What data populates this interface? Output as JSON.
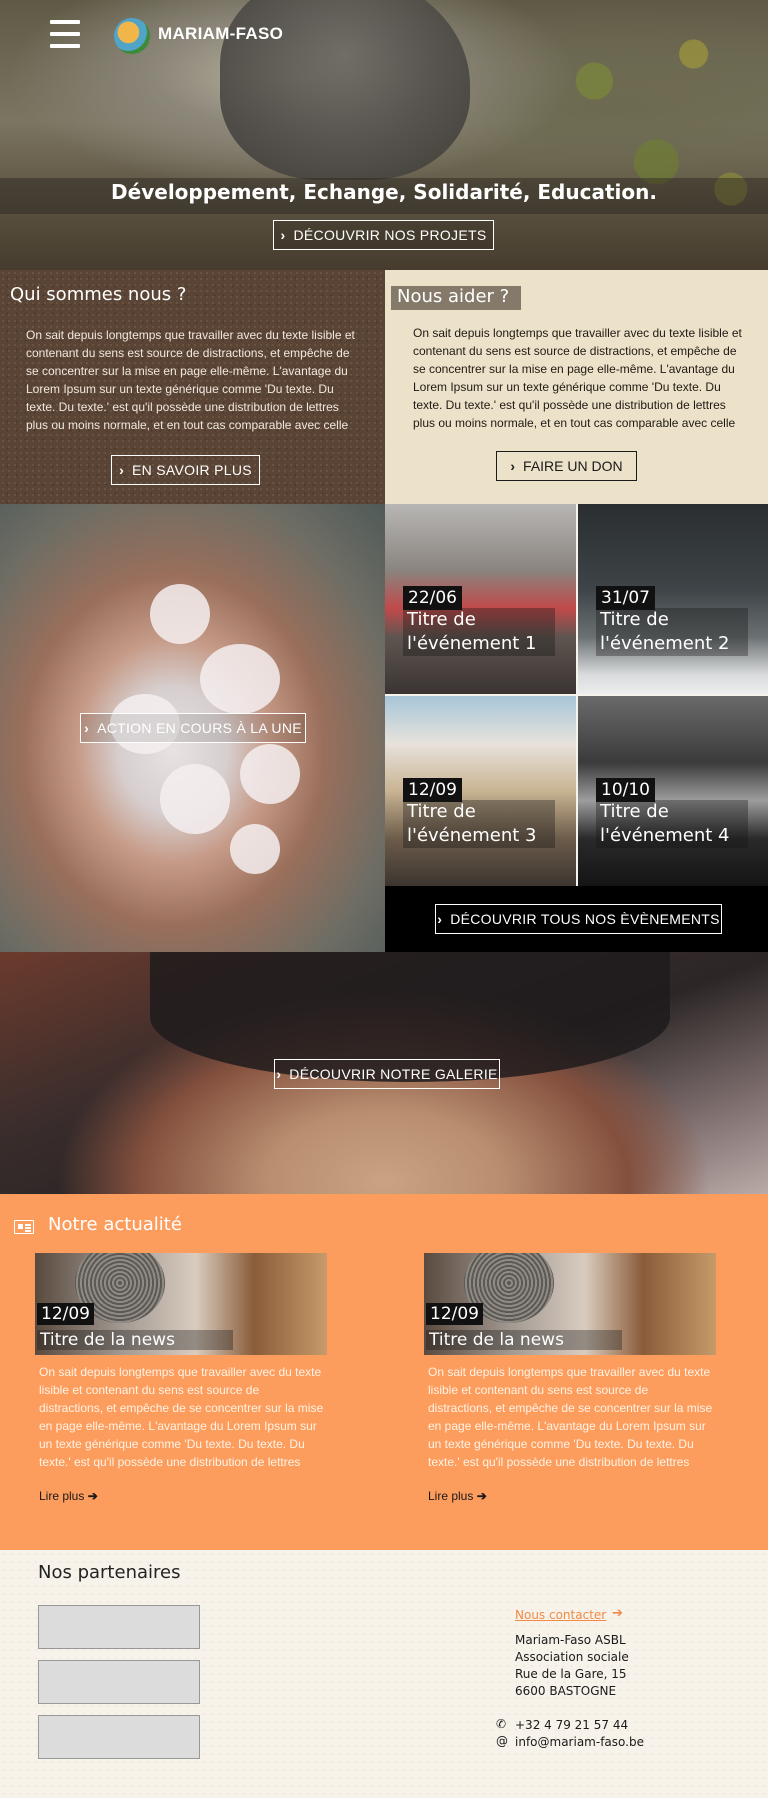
{
  "header": {
    "brand": "MARIAM-FASO",
    "tagline": "Développement, Echange, Solidarité, Education.",
    "cta": "DÉCOUVRIR NOS PROJETS"
  },
  "who": {
    "title": "Qui sommes nous ?",
    "text": "On sait depuis longtemps que travailler avec du texte lisible et contenant du sens est source de distractions, et empêche de se concentrer sur la mise en page elle-même. L'avantage du Lorem Ipsum sur un texte générique comme 'Du texte. Du texte. Du texte.' est qu'il possède une distribution de lettres plus ou moins normale, et en tout cas comparable avec celle",
    "button": "EN SAVOIR PLUS"
  },
  "help": {
    "title": "Nous aider ?",
    "text": "On sait depuis longtemps que travailler avec du texte lisible et contenant du sens est source de distractions, et empêche de se concentrer sur la mise en page elle-même. L'avantage du Lorem Ipsum sur un texte générique comme 'Du texte. Du texte. Du texte.' est qu'il possède une distribution de lettres plus ou moins normale, et en tout cas comparable avec celle",
    "button": "FAIRE UN DON"
  },
  "action": {
    "button": "ACTION EN COURS À LA UNE"
  },
  "events": {
    "items": [
      {
        "date": "22/06",
        "title": "Titre de l'événement 1"
      },
      {
        "date": "31/07",
        "title": "Titre de l'événement 2"
      },
      {
        "date": "12/09",
        "title": "Titre de l'événement 3"
      },
      {
        "date": "10/10",
        "title": "Titre de l'événement 4"
      }
    ],
    "button": "DÉCOUVRIR TOUS NOS ÈVÈNEMENTS"
  },
  "gallery": {
    "button": "DÉCOUVRIR NOTRE GALERIE"
  },
  "news": {
    "title": "Notre actualité",
    "items": [
      {
        "date": "12/09",
        "title": "Titre de la news",
        "text": "On sait depuis longtemps que travailler avec du texte lisible et contenant du sens est source de distractions, et empêche de se concentrer sur la mise en page elle-même. L'avantage du Lorem Ipsum sur un texte générique comme 'Du texte. Du texte. Du texte.' est qu'il possède une distribution de lettres",
        "more": "Lire plus"
      },
      {
        "date": "12/09",
        "title": "Titre de la news",
        "text": "On sait depuis longtemps que travailler avec du texte lisible et contenant du sens est source de distractions, et empêche de se concentrer sur la mise en page elle-même. L'avantage du Lorem Ipsum sur un texte générique comme 'Du texte. Du texte. Du texte.' est qu'il possède une distribution de lettres",
        "more": "Lire plus"
      }
    ]
  },
  "footer": {
    "partners_title": "Nos partenaires",
    "contact_link": "Nous contacter",
    "address": [
      "Mariam-Faso ASBL",
      "Association sociale",
      "Rue de la Gare, 15",
      "6600 BASTOGNE"
    ],
    "phone": "+32 4 79 21 57 44",
    "email": "info@mariam-faso.be"
  },
  "icons": {
    "menu": "hamburger-icon",
    "chevron": "chevron-right-icon",
    "news": "newspaper-icon",
    "phone": "phone-icon",
    "email": "at-icon",
    "arrow": "arrow-right-icon"
  },
  "colors": {
    "news_bg": "#fd9d5d",
    "who_bg": "#5a4435",
    "help_bg": "#ece1c9",
    "accent": "#f08a45"
  }
}
